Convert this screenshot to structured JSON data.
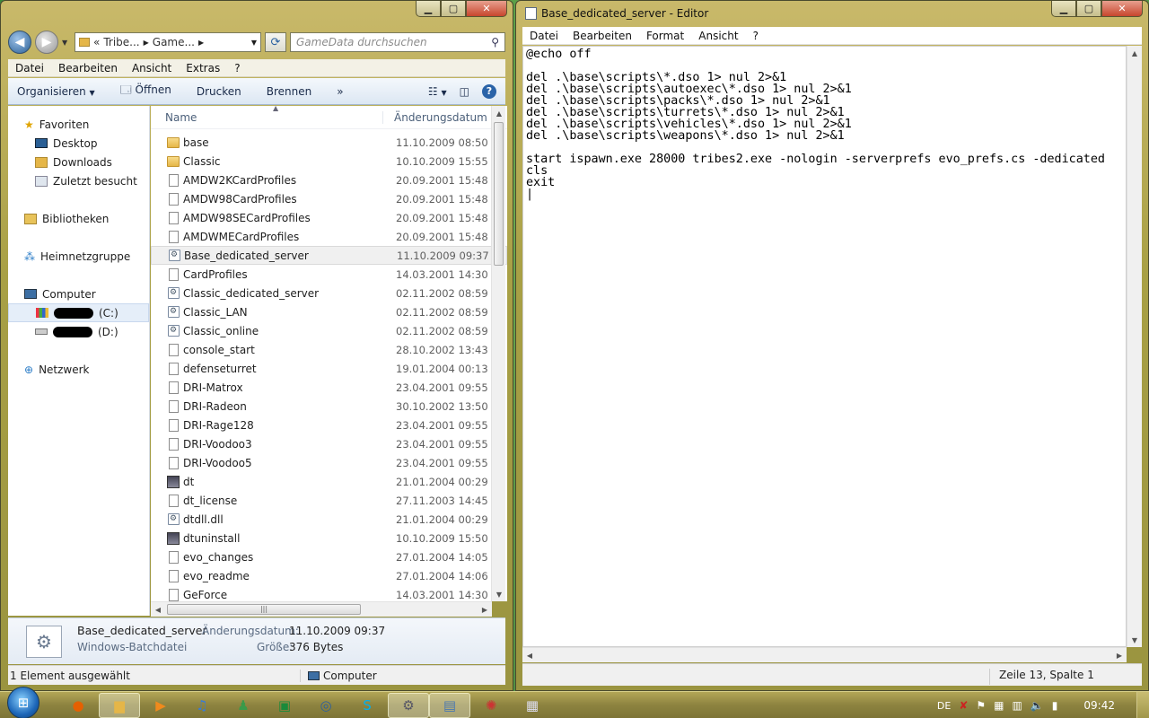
{
  "explorer": {
    "breadcrumbs": [
      "«",
      "Tribe...",
      "Game..."
    ],
    "search_placeholder": "GameData durchsuchen",
    "menu": [
      "Datei",
      "Bearbeiten",
      "Ansicht",
      "Extras",
      "?"
    ],
    "toolbar": {
      "organize": "Organisieren",
      "open": "Öffnen",
      "print": "Drucken",
      "burn": "Brennen",
      "more": "»"
    },
    "nav": {
      "favorites": "Favoriten",
      "desktop": "Desktop",
      "downloads": "Downloads",
      "recent": "Zuletzt besucht",
      "libraries": "Bibliotheken",
      "homegroup": "Heimnetzgruppe",
      "computer": "Computer",
      "drive_c": "(C:)",
      "drive_d": "(D:)",
      "network": "Netzwerk"
    },
    "columns": {
      "name": "Name",
      "date": "Änderungsdatum"
    },
    "files": [
      {
        "name": "base",
        "date": "11.10.2009 08:50",
        "type": "folder"
      },
      {
        "name": "Classic",
        "date": "10.10.2009 15:55",
        "type": "folder"
      },
      {
        "name": "AMDW2KCardProfiles",
        "date": "20.09.2001 15:48",
        "type": "file"
      },
      {
        "name": "AMDW98CardProfiles",
        "date": "20.09.2001 15:48",
        "type": "file"
      },
      {
        "name": "AMDW98SECardProfiles",
        "date": "20.09.2001 15:48",
        "type": "file"
      },
      {
        "name": "AMDWMECardProfiles",
        "date": "20.09.2001 15:48",
        "type": "file"
      },
      {
        "name": "Base_dedicated_server",
        "date": "11.10.2009 09:37",
        "type": "batch"
      },
      {
        "name": "CardProfiles",
        "date": "14.03.2001 14:30",
        "type": "file"
      },
      {
        "name": "Classic_dedicated_server",
        "date": "02.11.2002 08:59",
        "type": "batch"
      },
      {
        "name": "Classic_LAN",
        "date": "02.11.2002 08:59",
        "type": "batch"
      },
      {
        "name": "Classic_online",
        "date": "02.11.2002 08:59",
        "type": "batch"
      },
      {
        "name": "console_start",
        "date": "28.10.2002 13:43",
        "type": "file"
      },
      {
        "name": "defenseturret",
        "date": "19.01.2004 00:13",
        "type": "file"
      },
      {
        "name": "DRI-Matrox",
        "date": "23.04.2001 09:55",
        "type": "file"
      },
      {
        "name": "DRI-Radeon",
        "date": "30.10.2002 13:50",
        "type": "file"
      },
      {
        "name": "DRI-Rage128",
        "date": "23.04.2001 09:55",
        "type": "file"
      },
      {
        "name": "DRI-Voodoo3",
        "date": "23.04.2001 09:55",
        "type": "file"
      },
      {
        "name": "DRI-Voodoo5",
        "date": "23.04.2001 09:55",
        "type": "file"
      },
      {
        "name": "dt",
        "date": "21.01.2004 00:29",
        "type": "app"
      },
      {
        "name": "dt_license",
        "date": "27.11.2003 14:45",
        "type": "file"
      },
      {
        "name": "dtdll.dll",
        "date": "21.01.2004 00:29",
        "type": "batch"
      },
      {
        "name": "dtuninstall",
        "date": "10.10.2009 15:50",
        "type": "app"
      },
      {
        "name": "evo_changes",
        "date": "27.01.2004 14:05",
        "type": "file"
      },
      {
        "name": "evo_readme",
        "date": "27.01.2004 14:06",
        "type": "file"
      },
      {
        "name": "GeForce",
        "date": "14.03.2001 14:30",
        "type": "file"
      }
    ],
    "selected_file": "Base_dedicated_server",
    "details": {
      "name": "Base_dedicated_server",
      "type": "Windows-Batchdatei",
      "date_label": "Änderungsdatum:",
      "date_value": "11.10.2009 09:37",
      "size_label": "Größe:",
      "size_value": "376 Bytes"
    },
    "status": {
      "selection": "1 Element ausgewählt",
      "location": "Computer"
    }
  },
  "editor": {
    "title": "Base_dedicated_server - Editor",
    "menu": [
      "Datei",
      "Bearbeiten",
      "Format",
      "Ansicht",
      "?"
    ],
    "content": "@echo off\n\ndel .\\base\\scripts\\*.dso 1> nul 2>&1\ndel .\\base\\scripts\\autoexec\\*.dso 1> nul 2>&1\ndel .\\base\\scripts\\packs\\*.dso 1> nul 2>&1\ndel .\\base\\scripts\\turrets\\*.dso 1> nul 2>&1\ndel .\\base\\scripts\\vehicles\\*.dso 1> nul 2>&1\ndel .\\base\\scripts\\weapons\\*.dso 1> nul 2>&1\n\nstart ispawn.exe 28000 tribes2.exe -nologin -serverprefs evo_prefs.cs -dedicated\ncls\nexit\n|",
    "status_position": "Zeile 13, Spalte 1"
  },
  "taskbar": {
    "language": "DE",
    "clock": "09:42"
  }
}
